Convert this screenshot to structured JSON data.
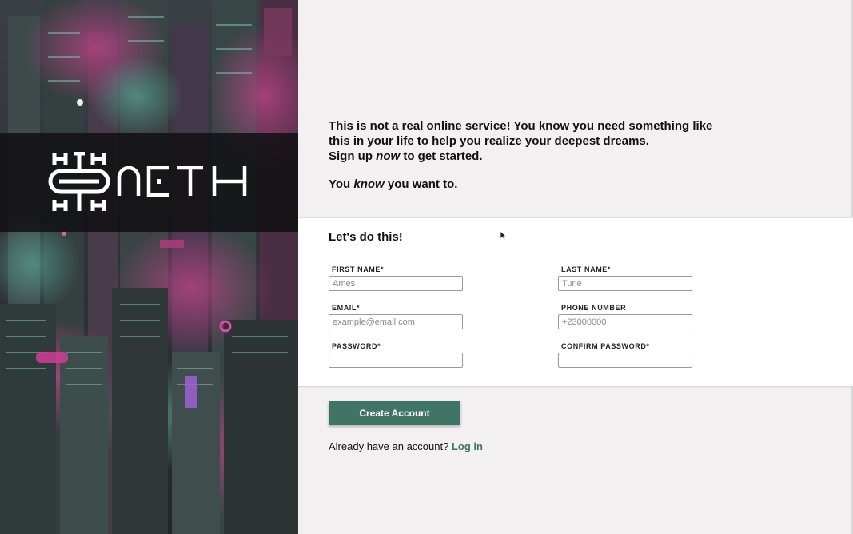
{
  "brand": {
    "name": "AETH"
  },
  "intro": {
    "line1": "This is not a real online service! You know you need something like this in your life to help you realize your deepest dreams.",
    "signup_prefix": "Sign up ",
    "signup_emphasis": "now",
    "signup_suffix": " to get started.",
    "want_prefix": "You ",
    "want_emphasis": "know",
    "want_suffix": " you want to."
  },
  "form": {
    "title": "Let's do this!",
    "fields": {
      "first_name": {
        "label": "FIRST NAME*",
        "placeholder": "Ames",
        "value": ""
      },
      "last_name": {
        "label": "LAST NAME*",
        "placeholder": "Turie",
        "value": ""
      },
      "email": {
        "label": "EMAIL*",
        "placeholder": "example@email.com",
        "value": ""
      },
      "phone": {
        "label": "PHONE NUMBER",
        "placeholder": "+23000000",
        "value": ""
      },
      "password": {
        "label": "PASSWORD*",
        "placeholder": "",
        "value": ""
      },
      "confirm_password": {
        "label": "CONFIRM PASSWORD*",
        "placeholder": "",
        "value": ""
      }
    }
  },
  "actions": {
    "create_label": "Create Account",
    "login_prompt": "Already have an account?",
    "login_link": "Log in"
  },
  "colors": {
    "accent": "#3e7565",
    "background": "#f3f0f1",
    "card": "#ffffff",
    "logo_band": "#121014",
    "text": "#111111"
  }
}
